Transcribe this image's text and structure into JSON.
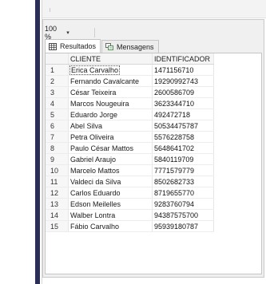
{
  "zoom": {
    "value": "100 %",
    "dropdown_icon": "chevron-down-icon"
  },
  "tabs": [
    {
      "label": "Resultados",
      "icon": "grid-icon",
      "active": true
    },
    {
      "label": "Mensagens",
      "icon": "messages-icon",
      "active": false
    }
  ],
  "grid": {
    "columns": [
      "CLIENTE",
      "IDENTIFICADOR"
    ],
    "selected_row": 1,
    "rows": [
      {
        "num": "1",
        "cliente": "Erica Carvalho",
        "identificador": "1471156710"
      },
      {
        "num": "2",
        "cliente": "Fernando Cavalcante",
        "identificador": "19290992743"
      },
      {
        "num": "3",
        "cliente": "César Teixeira",
        "identificador": "2600586709"
      },
      {
        "num": "4",
        "cliente": "Marcos Nougeuira",
        "identificador": "3623344710"
      },
      {
        "num": "5",
        "cliente": "Eduardo Jorge",
        "identificador": "492472718"
      },
      {
        "num": "6",
        "cliente": "Abel Silva",
        "identificador": "50534475787"
      },
      {
        "num": "7",
        "cliente": "Petra Oliveira",
        "identificador": "5576228758"
      },
      {
        "num": "8",
        "cliente": "Paulo César Mattos",
        "identificador": "5648641702"
      },
      {
        "num": "9",
        "cliente": "Gabriel Araujo",
        "identificador": "5840119709"
      },
      {
        "num": "10",
        "cliente": "Marcelo Mattos",
        "identificador": "7771579779"
      },
      {
        "num": "11",
        "cliente": "Valdeci da Silva",
        "identificador": "8502682733"
      },
      {
        "num": "12",
        "cliente": "Carlos Eduardo",
        "identificador": "8719655770"
      },
      {
        "num": "13",
        "cliente": "Edson Meilelles",
        "identificador": "9283760794"
      },
      {
        "num": "14",
        "cliente": "Walber Lontra",
        "identificador": "94387575700"
      },
      {
        "num": "15",
        "cliente": "Fábio Carvalho",
        "identificador": "95939180787"
      }
    ]
  },
  "colors": {
    "left_bar": "#2b2f57",
    "pane_background": "#f0f0f0",
    "grid_background": "#ffffff"
  }
}
